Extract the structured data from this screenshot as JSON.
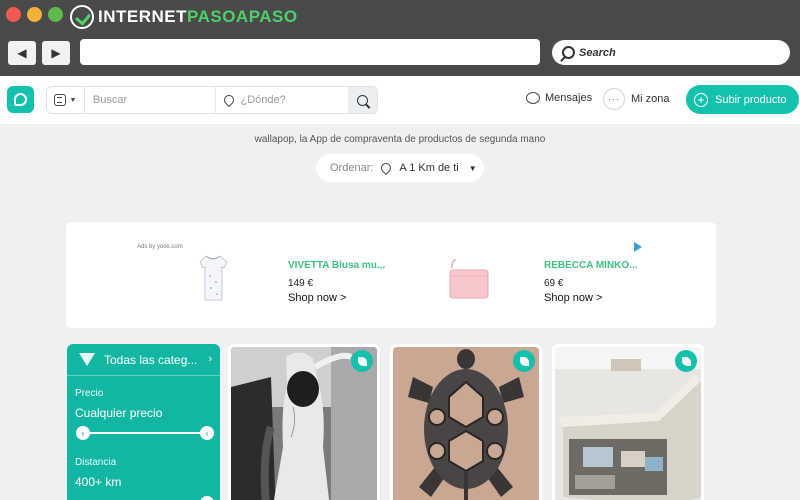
{
  "browser": {
    "brand_part1": "INTERNET",
    "brand_part2": "PASOAPASO",
    "search_placeholder": "Search",
    "back_icon": "back-arrow-icon",
    "forward_icon": "forward-arrow-icon"
  },
  "header": {
    "search_placeholder": "Buscar",
    "location_placeholder": "¿Dónde?",
    "messages_label": "Mensajes",
    "zone_label": "Mi zona",
    "zone_dots": "···",
    "upload_label": "Subir producto",
    "accent": "#13c1ac"
  },
  "main": {
    "tagline": "wallapop, la App de compraventa de productos de segunda mano",
    "order_label": "Ordenar:",
    "order_value": "A 1 Km de ti"
  },
  "ad": {
    "ads_by": "Ads by yoox.com",
    "products": [
      {
        "name": "VIVETTA Blusa mu...",
        "price": "149 €",
        "cta": "Shop now >"
      },
      {
        "name": "REBECCA MINKO...",
        "price": "69 €",
        "cta": "Shop now >"
      }
    ]
  },
  "filters": {
    "category_label": "Todas las categ...",
    "price_label": "Precio",
    "price_value": "Cualquier precio",
    "distance_label": "Distancia",
    "distance_value": "400+ km"
  },
  "cards": [
    {
      "image": "wedding-photo-bw",
      "badge_icon": "leaf-icon"
    },
    {
      "image": "turtle-tattoo-photo",
      "badge_icon": "leaf-icon"
    },
    {
      "image": "storage-bed-photo",
      "badge_icon": "leaf-icon"
    }
  ]
}
